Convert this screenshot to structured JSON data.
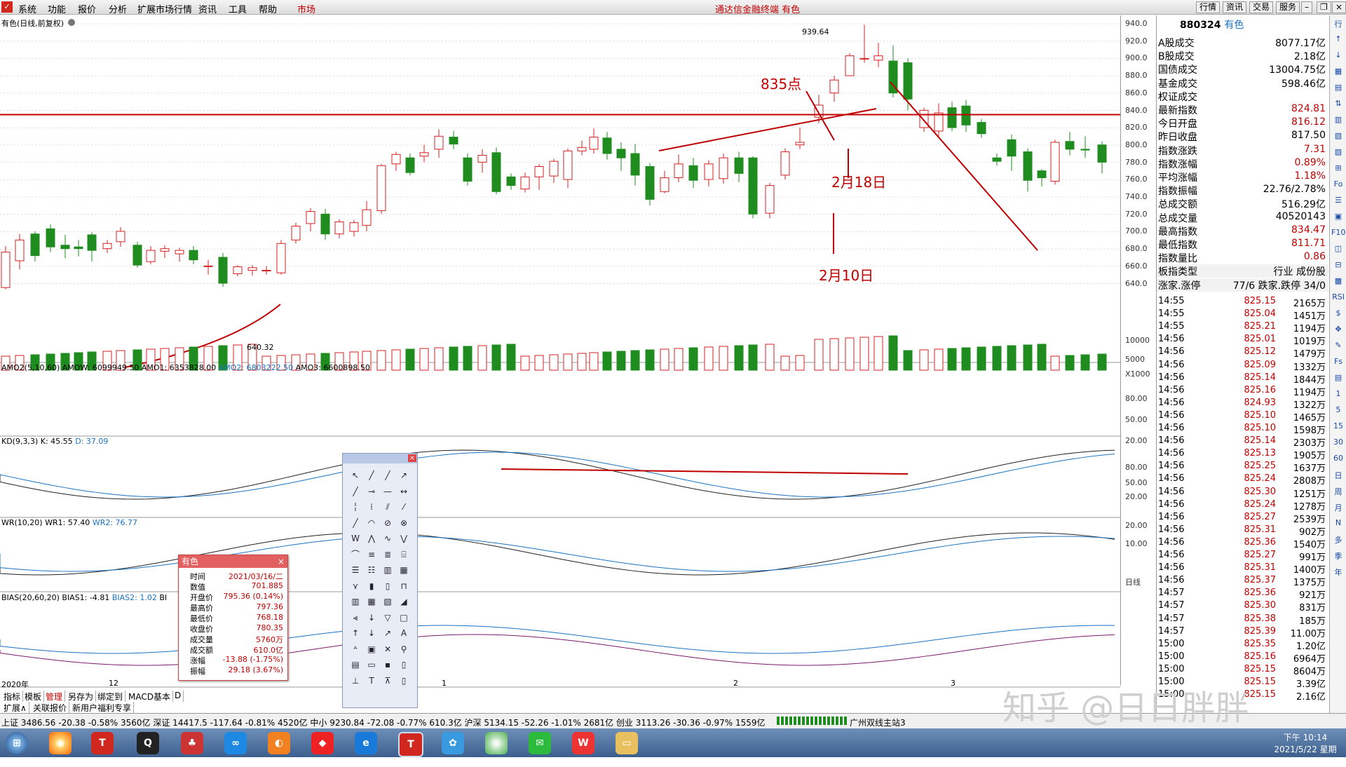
{
  "menu": {
    "items": [
      "系统",
      "功能",
      "报价",
      "分析",
      "扩展市场行情",
      "资讯",
      "工具",
      "帮助",
      "市场"
    ],
    "window_title": "通达信金融终端  有色",
    "right_buttons": [
      "行情",
      "资讯",
      "交易",
      "服务"
    ]
  },
  "chart": {
    "title": "有色(日线,前复权)",
    "price_axis": [
      "940.0",
      "920.0",
      "900.0",
      "880.0",
      "860.0",
      "840.0",
      "820.0",
      "800.0",
      "780.0",
      "760.0",
      "740.0",
      "720.0",
      "700.0",
      "680.0",
      "660.0",
      "640.0"
    ],
    "high_label": "939.64",
    "low_label": "640.32",
    "annotations": {
      "a1": "835点",
      "a2": "2月18日",
      "a3": "2月10日"
    },
    "x_labels": [
      "2020年",
      "12",
      "1",
      "2",
      "3"
    ],
    "period": "日线"
  },
  "amo_panel": {
    "title_prefix": "AMO2(5,10,60)",
    "amow": "AMOW: 6099949.50",
    "amo1": "AMO1: 6353828.00",
    "amo2": "AMO2: 6803222.50",
    "amo3": "AMO3: 6600898.50",
    "axis": [
      "10000",
      "5000"
    ],
    "unit": "X1000"
  },
  "kd_panel": {
    "title": "KD(9,3,3)",
    "k": "K: 45.55",
    "d": "D: 37.09",
    "axis": [
      "80.00",
      "50.00",
      "20.00"
    ]
  },
  "wr_panel": {
    "title": "WR(10,20)",
    "wr1": "WR1: 57.40",
    "wr2": "WR2: 76.77",
    "axis": [
      "80.00",
      "50.00",
      "20.00"
    ]
  },
  "bias_panel": {
    "title": "BIAS(20,60,20)",
    "bias1": "BIAS1: -4.81",
    "bias2": "BIAS2: 1.02",
    "bias3": "BI",
    "axis": [
      "20.00",
      "10.00"
    ]
  },
  "popup": {
    "title": "有色",
    "rows": [
      {
        "k": "时间",
        "v": "2021/03/16/二"
      },
      {
        "k": "数值",
        "v": "701.885"
      },
      {
        "k": "开盘价",
        "v": "795.36 (0.14%)"
      },
      {
        "k": "最高价",
        "v": "797.36"
      },
      {
        "k": "最低价",
        "v": "768.18"
      },
      {
        "k": "收盘价",
        "v": "780.35"
      },
      {
        "k": "成交量",
        "v": "5760万"
      },
      {
        "k": "成交额",
        "v": "610.0亿"
      },
      {
        "k": "涨幅",
        "v": "-13.88 (-1.75%)"
      },
      {
        "k": "振幅",
        "v": "29.18 (3.67%)"
      }
    ]
  },
  "quote": {
    "header_code": "880324",
    "header_name": "有色",
    "rows": [
      {
        "k": "A股成交",
        "v": "8077.17亿",
        "c": "#000"
      },
      {
        "k": "B股成交",
        "v": "2.18亿",
        "c": "#000"
      },
      {
        "k": "国债成交",
        "v": "13004.75亿",
        "c": "#000"
      },
      {
        "k": "基金成交",
        "v": "598.46亿",
        "c": "#000"
      },
      {
        "k": "权证成交",
        "v": "",
        "c": "#000"
      },
      {
        "k": "最新指数",
        "v": "824.81",
        "c": "#c00000"
      },
      {
        "k": "今日开盘",
        "v": "816.12",
        "c": "#c00000"
      },
      {
        "k": "昨日收盘",
        "v": "817.50",
        "c": "#000"
      },
      {
        "k": "指数涨跌",
        "v": "7.31",
        "c": "#c00000"
      },
      {
        "k": "指数涨幅",
        "v": "0.89%",
        "c": "#c00000"
      },
      {
        "k": "平均涨幅",
        "v": "1.18%",
        "c": "#c00000"
      },
      {
        "k": "指数振幅",
        "v": "22.76/2.78%",
        "c": "#000"
      },
      {
        "k": "总成交额",
        "v": "516.29亿",
        "c": "#000"
      },
      {
        "k": "总成交量",
        "v": "40520143",
        "c": "#000"
      },
      {
        "k": "最高指数",
        "v": "834.47",
        "c": "#c00000"
      },
      {
        "k": "最低指数",
        "v": "811.71",
        "c": "#c00000"
      },
      {
        "k": "指数量比",
        "v": "0.86",
        "c": "#c00000"
      },
      {
        "k": "板指类型",
        "v": "行业 成份股",
        "c": "#000"
      },
      {
        "k": "涨家.涨停",
        "v": "77/6  跌家.跌停     34/0",
        "c": "#000"
      }
    ],
    "ticks": [
      {
        "t": "14:55",
        "p": "825.15",
        "v": "2165万"
      },
      {
        "t": "14:55",
        "p": "825.04",
        "v": "1451万"
      },
      {
        "t": "14:55",
        "p": "825.21",
        "v": "1194万"
      },
      {
        "t": "14:56",
        "p": "825.01",
        "v": "1019万"
      },
      {
        "t": "14:56",
        "p": "825.12",
        "v": "1479万"
      },
      {
        "t": "14:56",
        "p": "825.09",
        "v": "1332万"
      },
      {
        "t": "14:56",
        "p": "825.14",
        "v": "1844万"
      },
      {
        "t": "14:56",
        "p": "825.16",
        "v": "1194万"
      },
      {
        "t": "14:56",
        "p": "824.93",
        "v": "1322万"
      },
      {
        "t": "14:56",
        "p": "825.10",
        "v": "1465万"
      },
      {
        "t": "14:56",
        "p": "825.10",
        "v": "1598万"
      },
      {
        "t": "14:56",
        "p": "825.14",
        "v": "2303万"
      },
      {
        "t": "14:56",
        "p": "825.13",
        "v": "1905万"
      },
      {
        "t": "14:56",
        "p": "825.25",
        "v": "1637万"
      },
      {
        "t": "14:56",
        "p": "825.24",
        "v": "2808万"
      },
      {
        "t": "14:56",
        "p": "825.30",
        "v": "1251万"
      },
      {
        "t": "14:56",
        "p": "825.24",
        "v": "1278万"
      },
      {
        "t": "14:56",
        "p": "825.27",
        "v": "2539万"
      },
      {
        "t": "14:56",
        "p": "825.31",
        "v": "902万"
      },
      {
        "t": "14:56",
        "p": "825.36",
        "v": "1540万"
      },
      {
        "t": "14:56",
        "p": "825.27",
        "v": "991万"
      },
      {
        "t": "14:56",
        "p": "825.31",
        "v": "1400万"
      },
      {
        "t": "14:56",
        "p": "825.37",
        "v": "1375万"
      },
      {
        "t": "14:57",
        "p": "825.36",
        "v": "921万"
      },
      {
        "t": "14:57",
        "p": "825.30",
        "v": "831万"
      },
      {
        "t": "14:57",
        "p": "825.38",
        "v": "185万"
      },
      {
        "t": "14:57",
        "p": "825.39",
        "v": "11.00万"
      },
      {
        "t": "15:00",
        "p": "825.35",
        "v": "1.20亿"
      },
      {
        "t": "15:00",
        "p": "825.16",
        "v": "6964万"
      },
      {
        "t": "15:00",
        "p": "825.15",
        "v": "8604万"
      },
      {
        "t": "15:00",
        "p": "825.15",
        "v": "3.39亿"
      },
      {
        "t": "15:00",
        "p": "825.15",
        "v": "2.16亿"
      }
    ]
  },
  "right_tools": [
    "行",
    "↑",
    "↓",
    "▦",
    "▤",
    "⇅",
    "▥",
    "▧",
    "▨",
    "⊞",
    "Fo",
    "☰",
    "▣",
    "F10",
    "◫",
    "⊟",
    "▩",
    "RSI",
    "$",
    "✥",
    "✎",
    "Fs",
    "▤",
    "1",
    "5",
    "15",
    "30",
    "60",
    "日",
    "周",
    "月",
    "N",
    "多",
    "季",
    "年"
  ],
  "bottom_tabs": [
    "指标",
    "模板",
    "管理",
    "另存为",
    "绑定到",
    "MACD基本",
    "D"
  ],
  "bottom_tabs2": [
    "扩展∧",
    "关联报价",
    "新用户福利专享"
  ],
  "status": {
    "text": "上证 3486.56  -20.38  -0.58% 3560亿   深证 14417.5  -117.64  -0.81% 4520亿   中小 9230.84  -72.08  -0.77% 610.3亿   沪深 5134.15  -52.26  -1.01% 2681亿   创业 3113.26  -30.36  -0.97% 1559亿",
    "station": "广州双线主站3"
  },
  "taskbar": {
    "time": "下午 10:14",
    "date": "2021/5/22 星期六"
  },
  "watermark": "知乎 @日日胖胖",
  "colors": {
    "up": "#d42020",
    "down": "#1e8c1e",
    "accent": "#c00000"
  }
}
